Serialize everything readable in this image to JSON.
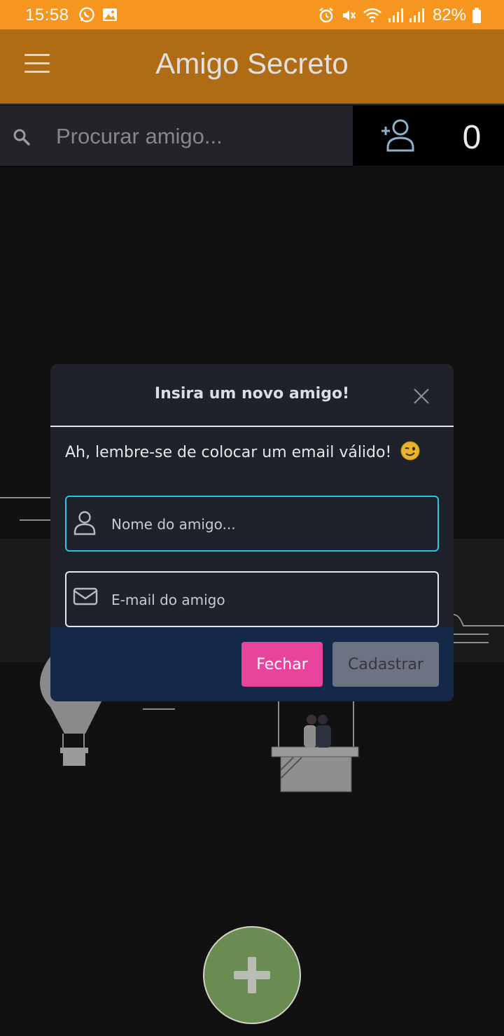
{
  "status_bar": {
    "time": "15:58",
    "battery": "82%",
    "left_icons": [
      "whatsapp-icon",
      "image-icon"
    ],
    "right_icons": [
      "alarm-icon",
      "mute-icon",
      "wifi-icon",
      "signal-icon",
      "signal-icon",
      "battery-icon"
    ]
  },
  "app_bar": {
    "title": "Amigo Secreto",
    "menu_icon": "menu-icon"
  },
  "search": {
    "placeholder": "Procurar amigo...",
    "value": "",
    "icon": "search-icon"
  },
  "counter": {
    "icon": "add-friend-icon",
    "value": "0"
  },
  "modal": {
    "title": "Insira um novo amigo!",
    "message": "Ah, lembre-se de colocar um email válido!",
    "emoji": "wink-emoji",
    "name_field": {
      "placeholder": "Nome do amigo...",
      "value": "",
      "icon": "user-icon"
    },
    "email_field": {
      "placeholder": "E-mail do amigo",
      "value": "",
      "icon": "envelope-icon"
    },
    "close_button": "Fechar",
    "submit_button": "Cadastrar"
  },
  "fab": {
    "icon": "plus-icon"
  },
  "colors": {
    "status_bar": "#f6961f",
    "app_bar": "#b06c14",
    "background": "#111111",
    "modal": "#1f222b",
    "modal_footer": "#14284a",
    "focus_border": "#2ec3e6",
    "close_button": "#e8449c",
    "submit_button": "#6d7382",
    "fab": "#6a8b51"
  }
}
